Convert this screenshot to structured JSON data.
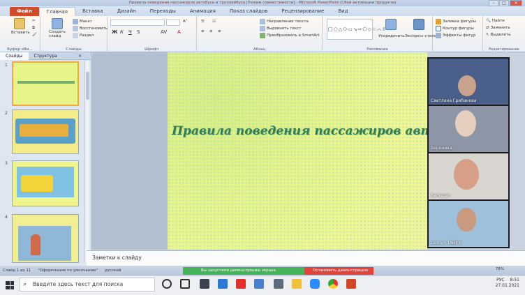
{
  "window": {
    "title": "Правила поведения пассажиров автобуса и троллейбуса [Режим совместимости] - Microsoft PowerPoint (Сбой активации продукта)"
  },
  "tabs": [
    "Файл",
    "Главная",
    "Вставка",
    "Дизайн",
    "Переходы",
    "Анимация",
    "Показ слайдов",
    "Рецензирование",
    "Вид"
  ],
  "ribbon": {
    "paste": "Вставить",
    "create_slide": "Создать слайд",
    "layout": "Макет",
    "restore": "Восстановить",
    "section": "Раздел",
    "clipboard_label": "Буфер обм...",
    "slides_label": "Слайды",
    "font_label": "Шрифт",
    "paragraph_label": "Абзац",
    "text_direction": "Направление текста",
    "align_text": "Выровнять текст",
    "smartart": "Преобразовать в SmartArt",
    "arrange": "Упорядочить",
    "quick_styles": "Экспресс-стили",
    "drawing_label": "Рисование",
    "shape_fill": "Заливка фигуры",
    "shape_outline": "Контур фигуры",
    "shape_effects": "Эффекты фигур",
    "find": "Найти",
    "replace": "Заменить",
    "select": "Выделить",
    "editing_label": "Редактирование"
  },
  "panel": {
    "tab_slides": "Слайды",
    "tab_outline": "Структура",
    "close": "×",
    "slide_numbers": [
      "1",
      "2",
      "3",
      "4"
    ]
  },
  "slide": {
    "title": "Правила поведения пассажиров автобуса и троллейбуса"
  },
  "video": {
    "participants": [
      "Светлана Грибанова",
      "Вероника",
      "Ramazan",
      "Lenovo TAB4 8"
    ]
  },
  "notes": {
    "placeholder": "Заметки к слайду"
  },
  "status": {
    "slide": "Слайд 1 из 11",
    "theme": "\"Оформление по умолчанию\"",
    "lang": "русский",
    "sharing": "Вы запустили демонстрацию экрана",
    "stop_sharing": "Остановить демонстрацию",
    "zoom": "78%"
  },
  "taskbar": {
    "search_placeholder": "Введите здесь текст для поиска",
    "lang": "РУС",
    "time": "8:51",
    "date": "27.01.2021"
  }
}
